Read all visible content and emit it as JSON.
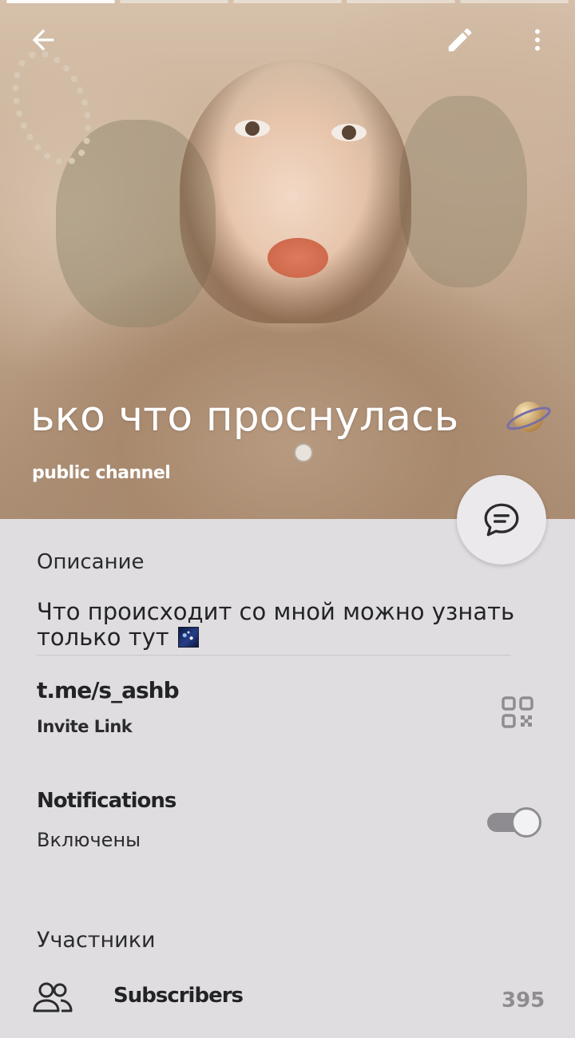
{
  "header": {
    "story_segments": 5,
    "active_segment": 1,
    "channel_title": "ько что проснулась",
    "channel_type": "public channel"
  },
  "info": {
    "description_heading": "Описание",
    "description_text": "Что происходит со мной можно узнать только тут",
    "invite_link": "t.me/s_ashb",
    "invite_link_label": "Invite Link",
    "notifications_title": "Notifications",
    "notifications_status": "Включены",
    "notifications_enabled": true
  },
  "members": {
    "heading": "Участники",
    "subscribers_label": "Subscribers",
    "subscribers_count": "395"
  },
  "icons": {
    "back": "arrow-left-icon",
    "edit": "pencil-icon",
    "more": "more-vertical-icon",
    "message": "chat-bubble-icon",
    "qr": "qr-code-icon",
    "subscribers": "people-icon",
    "title_emoji": "ringed-planet-icon",
    "description_emoji": "milky-way-icon"
  },
  "colors": {
    "background": "#dfdde0",
    "text_primary": "#232325",
    "toggle_track": "#8e8c90",
    "count_text": "#8f8d91"
  }
}
